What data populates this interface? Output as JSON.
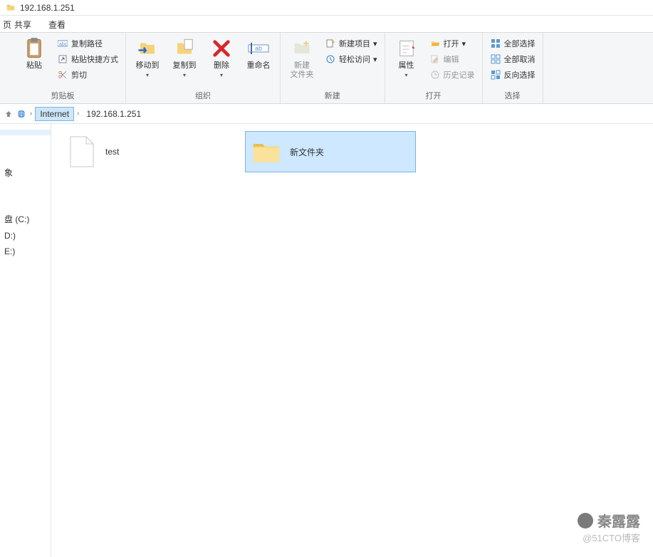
{
  "title": "192.168.1.251",
  "tabs": {
    "home_stub": "页",
    "share": "共享",
    "view": "查看"
  },
  "ribbon": {
    "clipboard": {
      "paste": "粘贴",
      "copy_path": "复制路径",
      "paste_shortcut": "粘贴快捷方式",
      "cut": "剪切",
      "group": "剪贴板"
    },
    "organize": {
      "move_to": "移动到",
      "copy_to": "复制到",
      "delete": "删除",
      "rename": "重命名",
      "group": "组织"
    },
    "new": {
      "new_folder": "新建\n文件夹",
      "new_item": "新建项目",
      "easy_access": "轻松访问",
      "group": "新建"
    },
    "open": {
      "properties": "属性",
      "open": "打开",
      "edit": "编辑",
      "history": "历史记录",
      "group": "打开"
    },
    "select": {
      "select_all": "全部选择",
      "select_none": "全部取消",
      "invert": "反向选择",
      "group": "选择"
    }
  },
  "address": {
    "root": "Internet",
    "path": "192.168.1.251"
  },
  "sidebar": {
    "items": [
      "",
      "象",
      "",
      "盘 (C:)",
      "D:)",
      "E:)"
    ]
  },
  "files": [
    {
      "name": "test",
      "type": "file",
      "selected": false
    },
    {
      "name": "新文件夹",
      "type": "folder",
      "selected": true
    }
  ],
  "watermark": {
    "line1": "秦露露",
    "line2": "@51CTO博客"
  }
}
